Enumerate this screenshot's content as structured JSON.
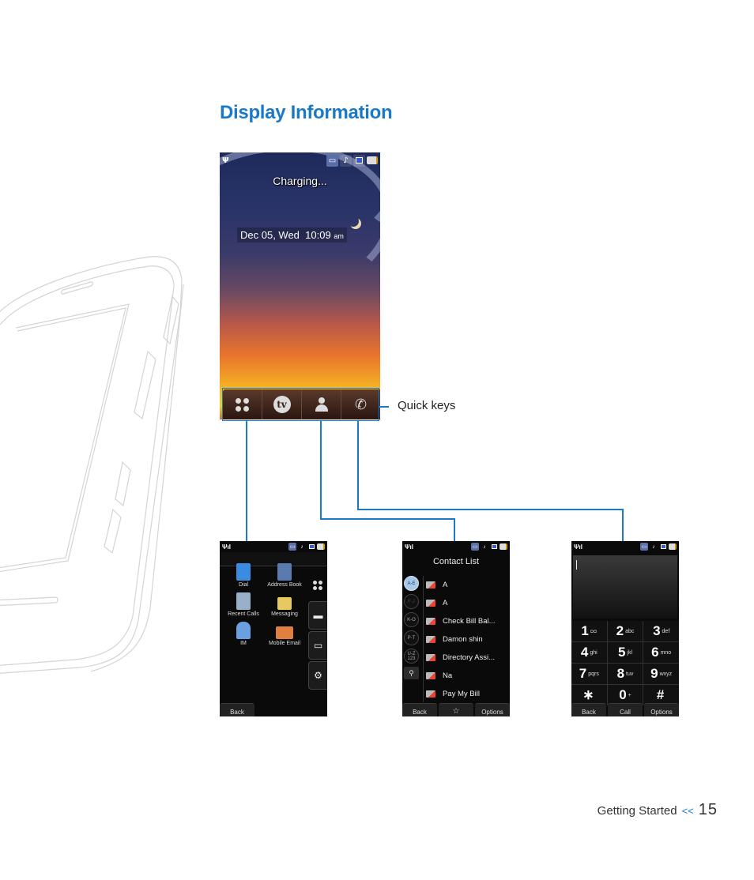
{
  "page": {
    "title": "Display Information",
    "footer": {
      "section": "Getting Started",
      "separator": "<<",
      "page_number": "15"
    }
  },
  "colors": {
    "accent": "#1a7ac8"
  },
  "main_screen": {
    "status_icons": [
      "signal-icon",
      "voicemail-icon",
      "music-note-icon",
      "multitask-icon",
      "battery-charging-icon"
    ],
    "charging_text": "Charging...",
    "date": "Dec 05, Wed",
    "time": "10:09",
    "ampm": "am",
    "quick_keys": [
      {
        "name": "menu",
        "icon": "menu-grid-icon"
      },
      {
        "name": "tv",
        "icon": "tv-icon",
        "glyph": "tv"
      },
      {
        "name": "contacts",
        "icon": "contact-icon"
      },
      {
        "name": "dial",
        "icon": "phone-icon",
        "glyph": "✆"
      }
    ],
    "callout_label": "Quick keys"
  },
  "menu_screen": {
    "items": [
      {
        "label": "Dial",
        "color": "#3a8ce0"
      },
      {
        "label": "Address Book",
        "color": "#5a7ab0"
      },
      {
        "label": "Recent Calls",
        "color": "#9ab0c8"
      },
      {
        "label": "Messaging",
        "color": "#e8c860"
      },
      {
        "label": "IM",
        "color": "#6aa0e0"
      },
      {
        "label": "Mobile Email",
        "color": "#e08040"
      }
    ],
    "side_tabs": [
      "menu-grid-icon",
      "multimedia-icon",
      "folder-icon",
      "settings-icon"
    ],
    "back_label": "Back"
  },
  "contacts_screen": {
    "title": "Contact List",
    "alpha_groups": [
      "A-E",
      "F-J",
      "K-O",
      "P-T",
      "U-Z 123"
    ],
    "contacts": [
      "A",
      "A",
      "Check Bill Bal...",
      "Damon shin",
      "Directory Assi...",
      "Na",
      "Pay My Bill"
    ],
    "buttons": {
      "back": "Back",
      "favorite": "☆",
      "options": "Options"
    }
  },
  "dialer_screen": {
    "keys": [
      {
        "digit": "1",
        "letters": "ᴑᴑ"
      },
      {
        "digit": "2",
        "letters": "abc"
      },
      {
        "digit": "3",
        "letters": "def"
      },
      {
        "digit": "4",
        "letters": "ghi"
      },
      {
        "digit": "5",
        "letters": "jkl"
      },
      {
        "digit": "6",
        "letters": "mno"
      },
      {
        "digit": "7",
        "letters": "pqrs"
      },
      {
        "digit": "8",
        "letters": "tuv"
      },
      {
        "digit": "9",
        "letters": "wxyz"
      },
      {
        "digit": "∗",
        "letters": ""
      },
      {
        "digit": "0",
        "letters": "+"
      },
      {
        "digit": "#",
        "letters": ""
      }
    ],
    "buttons": {
      "back": "Back",
      "call": "Call",
      "options": "Options"
    }
  }
}
